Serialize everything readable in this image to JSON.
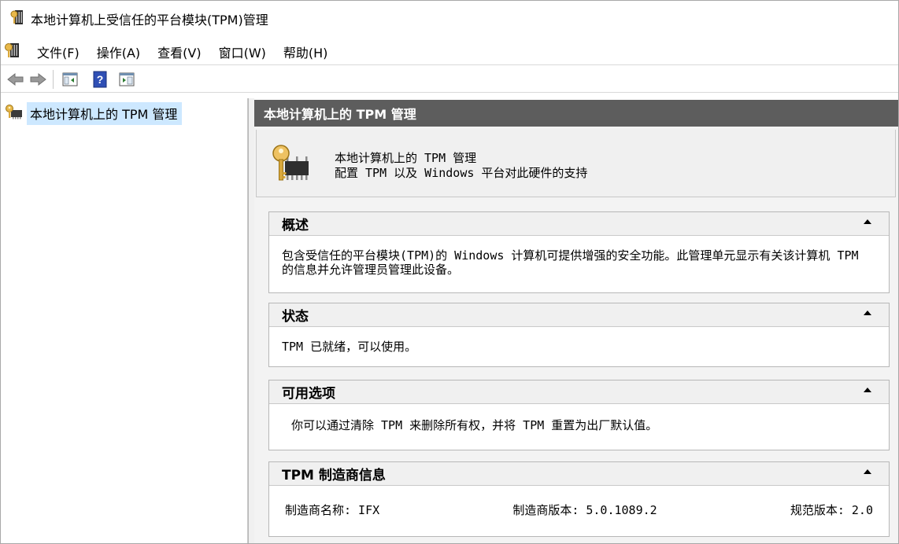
{
  "window": {
    "title": "本地计算机上受信任的平台模块(TPM)管理"
  },
  "menu": {
    "items": [
      "文件(F)",
      "操作(A)",
      "查看(V)",
      "窗口(W)",
      "帮助(H)"
    ]
  },
  "toolbar": {
    "icons": [
      "back-arrow-icon",
      "forward-arrow-icon",
      "show-hide-console-tree-icon",
      "help-icon",
      "show-hide-action-pane-icon"
    ]
  },
  "tree": {
    "root_label": "本地计算机上的 TPM 管理"
  },
  "content": {
    "header": "本地计算机上的 TPM 管理",
    "banner_title": "本地计算机上的 TPM 管理",
    "banner_subtitle": "配置 TPM 以及 Windows 平台对此硬件的支持",
    "sections": [
      {
        "title": "概述",
        "body": "包含受信任的平台模块(TPM)的 Windows 计算机可提供增强的安全功能。此管理单元显示有关该计算机 TPM 的信息并允许管理员管理此设备。"
      },
      {
        "title": "状态",
        "body": "TPM 已就绪，可以使用。"
      },
      {
        "title": "可用选项",
        "body": "你可以通过清除 TPM 来删除所有权，并将 TPM 重置为出厂默认值。"
      },
      {
        "title": "TPM 制造商信息",
        "manufacturer_name": "制造商名称: IFX",
        "manufacturer_version": "制造商版本: 5.0.1089.2",
        "spec_version": "规范版本: 2.0"
      }
    ]
  },
  "colors": {
    "header_bg": "#5d5d5d",
    "selection_bg": "#cde8ff",
    "section_head_bg": "#f0f0f0"
  }
}
